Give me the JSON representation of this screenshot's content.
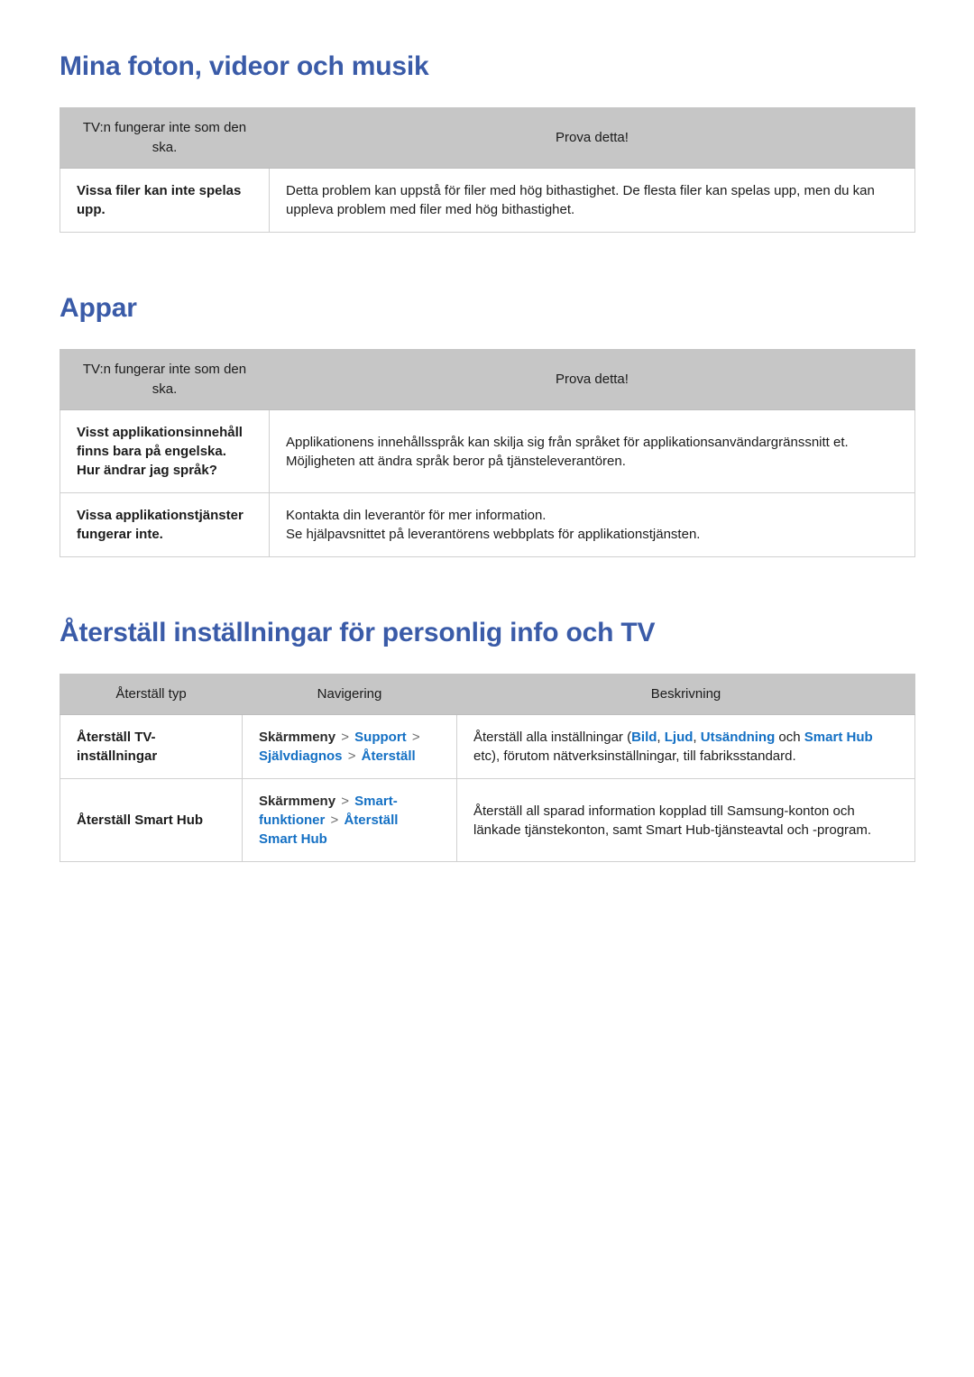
{
  "document": {
    "language": "sv",
    "accent_title_color": "#3a5ba8",
    "link_color": "#1470c4",
    "table_header_bg": "#c6c6c6",
    "table_border_color": "#d0d0d0"
  },
  "sections": [
    {
      "id": "mina-foton-videor-och-musik",
      "title": "Mina foton, videor och musik",
      "table": {
        "headers": [
          "TV:n fungerar inte som den ska.",
          "Prova detta!"
        ],
        "rows": [
          {
            "key": "Vissa filer kan inte spelas upp.",
            "body": "Detta problem kan uppstå för filer med hög bithastighet. De flesta filer kan spelas upp, men du kan uppleva problem med filer med hög bithastighet."
          }
        ]
      }
    },
    {
      "id": "appar",
      "title": "Appar",
      "table": {
        "headers": [
          "TV:n fungerar inte som den ska.",
          "Prova detta!"
        ],
        "rows": [
          {
            "key": "Visst applikationsinnehåll finns bara på engelska. Hur ändrar jag språk?",
            "body": "Applikationens innehållsspråk kan skilja sig från språket för applikationsanvändargränssnitt et. Möjligheten att ändra språk beror på tjänsteleverantören."
          },
          {
            "key": "Vissa applikationstjänster fungerar inte.",
            "body": "Kontakta din leverantör för mer information.\nSe hjälpavsnittet på leverantörens webbplats för applikationstjänsten."
          }
        ]
      }
    },
    {
      "id": "aterstall-installningar",
      "title": "Återställ inställningar för personlig info och TV",
      "table": {
        "headers": [
          "Återställ typ",
          "Navigering",
          "Beskrivning"
        ],
        "rows": [
          {
            "type": "Återställ TV-inställningar",
            "navigation": {
              "root": "Skärmmeny",
              "separator": ">",
              "steps": [
                "Support",
                "Självdiagnos",
                "Återställ"
              ]
            },
            "description": {
              "lead": "Återställ alla inställningar (",
              "terms": [
                "Bild",
                "Ljud",
                "Utsändning",
                "Smart Hub"
              ],
              "conjunction": "och",
              "tail": "etc), förutom nätverksinställningar, till fabriksstandard."
            }
          },
          {
            "type": "Återställ Smart Hub",
            "navigation": {
              "root": "Skärmmeny",
              "separator": ">",
              "steps": [
                "Smart-funktioner",
                "Återställ Smart Hub"
              ]
            },
            "description": {
              "lead": "Återställ all sparad information kopplad till Samsung-konton och länkade tjänstekonton, samt Smart Hub-tjänsteavtal och -program.",
              "terms": [],
              "conjunction": "",
              "tail": ""
            }
          }
        ]
      }
    }
  ]
}
